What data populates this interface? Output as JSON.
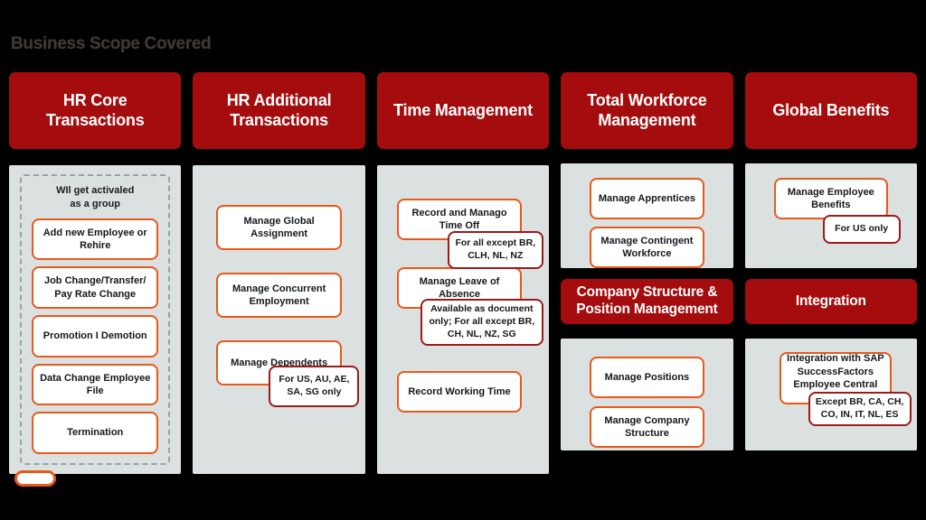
{
  "slide": {
    "title": "Business Scope Covered",
    "legend_pill_label": ""
  },
  "theme": {
    "header_red": "#a50c0d",
    "panel_grey": "#dbe1e1",
    "item_orange": "#e8591a",
    "note_dark_red": "#9b1b1b",
    "title_grey": "#3b3b3b",
    "box_white": "#ffffff"
  },
  "columns": [
    {
      "id": "hr-core-transactions",
      "header": "HR Core Transactions",
      "group_caption": "WIl get activaled\nas a group",
      "group_caption_line1": "WIl get activaled",
      "group_caption_line2": "as a group",
      "items": [
        {
          "label": "Add new Employee or Rehire"
        },
        {
          "label": "Job Change/Transfer/ Pay Rate Change"
        },
        {
          "label": "Promotion I Demotion"
        },
        {
          "label": "Data Change Employee File"
        },
        {
          "label": "Termination"
        }
      ]
    },
    {
      "id": "hr-additional-transactions",
      "header": "HR Additional Transactions",
      "items": [
        {
          "label": "Manage Global Assignment"
        },
        {
          "label": "Manage Concurrent Employment"
        },
        {
          "label": "Manage Dependents"
        }
      ],
      "notes": [
        {
          "label": "For US, AU, AE, SA, SG only"
        }
      ]
    },
    {
      "id": "time-management",
      "header": "Time Management",
      "items": [
        {
          "label": "Record and Manago Time Off"
        },
        {
          "label": "Manage Leave of Absence"
        },
        {
          "label": "Record Working Time"
        }
      ],
      "notes": [
        {
          "label": "For all except BR, CLH, NL, NZ"
        },
        {
          "label": "Available as document only; For all except BR, CH, NL, NZ, SG"
        }
      ]
    },
    {
      "id": "total-workforce-management",
      "header": "Total Workforce Management",
      "items": [
        {
          "label": "Manage Apprentices"
        },
        {
          "label": "Manage Contingent Workforce"
        }
      ],
      "sub_header": "Company Structure & Position Management",
      "sub_items": [
        {
          "label": "Manage Positions"
        },
        {
          "label": "Manage Company Structure"
        }
      ]
    },
    {
      "id": "global-benefits",
      "header": "Global Benefits",
      "items": [
        {
          "label": "Manage Employee Benefits"
        }
      ],
      "notes": [
        {
          "label": "For US only"
        }
      ],
      "sub_header": "Integration",
      "sub_items": [
        {
          "label": "Integration with SAP SuccessFactors Employee Central Payroll"
        }
      ],
      "sub_notes": [
        {
          "label": "Except BR, CA, CH, CO, IN, IT, NL, ES"
        }
      ]
    }
  ]
}
